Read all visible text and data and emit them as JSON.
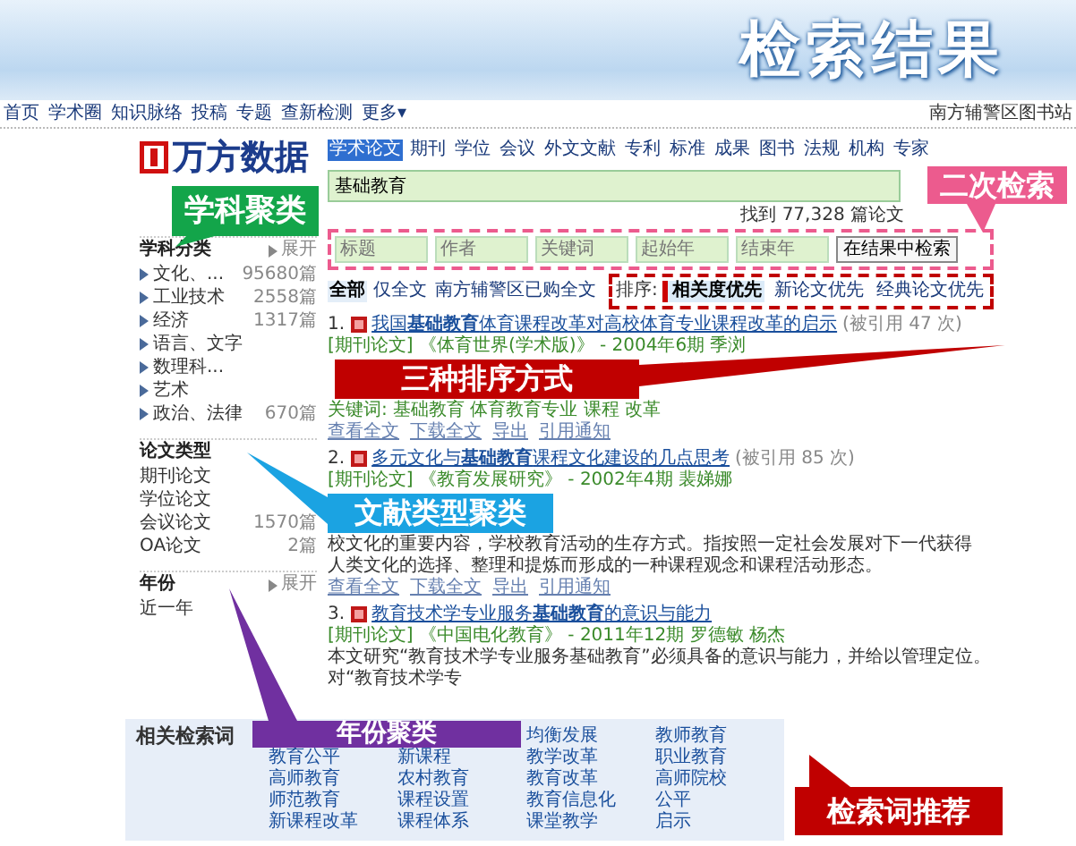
{
  "banner": {
    "title": "检索结果"
  },
  "top_nav": {
    "links": [
      "首页",
      "学术圈",
      "知识脉络",
      "投稿",
      "专题",
      "查新检测",
      "更多▾"
    ],
    "account": "南方辅警区图书站"
  },
  "logo": {
    "text": "万方数据"
  },
  "search": {
    "tabs": [
      {
        "label": "学术论文",
        "selected": true
      },
      {
        "label": "期刊",
        "selected": false
      },
      {
        "label": "学位",
        "selected": false
      },
      {
        "label": "会议",
        "selected": false
      },
      {
        "label": "外文文献",
        "selected": false
      },
      {
        "label": "专利",
        "selected": false
      },
      {
        "label": "标准",
        "selected": false
      },
      {
        "label": "成果",
        "selected": false
      },
      {
        "label": "图书",
        "selected": false
      },
      {
        "label": "法规",
        "selected": false
      },
      {
        "label": "机构",
        "selected": false
      },
      {
        "label": "专家",
        "selected": false
      }
    ],
    "query": "基础教育",
    "found": "找到 77,328 篇论文"
  },
  "refine": {
    "fields": [
      {
        "placeholder": "标题"
      },
      {
        "placeholder": "作者"
      },
      {
        "placeholder": "关键词"
      },
      {
        "placeholder": "起始年"
      },
      {
        "placeholder": "结束年"
      }
    ],
    "button": "在结果中检索"
  },
  "scope": [
    {
      "label": "全部",
      "selected": true
    },
    {
      "label": "仅全文",
      "selected": false
    },
    {
      "label": "南方辅警区已购全文",
      "selected": false
    }
  ],
  "sort": {
    "label": "排序:",
    "options": [
      {
        "label": "相关度优先",
        "selected": true
      },
      {
        "label": "新论文优先",
        "selected": false
      },
      {
        "label": "经典论文优先",
        "selected": false
      }
    ]
  },
  "results": [
    {
      "number": "1.",
      "title": "我国**基础教育**体育课程改革对高校体育专业课程改革的启示",
      "cited": "(被引用 47 次)",
      "meta": "[期刊论文] 《体育世界(学术版)》 - 2004年6期 季浏",
      "keywords": "关键词: 基础教育 体育教育专业 课程 改革",
      "actions": [
        "查看全文",
        "下载全文",
        "导出",
        "引用通知"
      ]
    },
    {
      "number": "2.",
      "title": "多元文化与**基础教育**课程文化建设的几点思考",
      "cited": "(被引用 85 次)",
      "meta": "[期刊论文] 《教育发展研究》 - 2002年4期 裴娣娜",
      "snippet": [
        "校文化的重要内容，学校教育活动的生存方式。指按照一定社会发展对下一代获得",
        "人类文化的选择、整理和提炼而形成的一种课程观念和课程活动形态。"
      ],
      "actions": [
        "查看全文",
        "下载全文",
        "导出",
        "引用通知"
      ]
    },
    {
      "number": "3.",
      "title": "教育技术学专业服务**基础教育**的意识与能力",
      "meta": "[期刊论文] 《中国电化教育》 - 2011年12期 罗德敏 杨杰",
      "snippet": [
        "本文研究“教育技术学专业服务基础教育”必须具备的意识与能力，并给以管理定位。对“教育技术学专"
      ]
    }
  ],
  "sidebar": {
    "sections": [
      {
        "title": "学科分类",
        "expand": "展开",
        "items": [
          {
            "label": "文化、...",
            "count": "95680篇"
          },
          {
            "label": "工业技术",
            "count": "2558篇"
          },
          {
            "label": "经济",
            "count": "1317篇"
          },
          {
            "label": "语言、文字"
          },
          {
            "label": "数理科..."
          },
          {
            "label": "艺术"
          },
          {
            "label": "政治、法律",
            "count": "670篇"
          }
        ]
      },
      {
        "title": "论文类型",
        "items": [
          {
            "label": "期刊论文"
          },
          {
            "label": "学位论文"
          },
          {
            "label": "会议论文",
            "count": "1570篇"
          },
          {
            "label": "OA论文",
            "count": "2篇"
          }
        ]
      },
      {
        "title": "年份",
        "expand": "展开",
        "items": [
          {
            "label": "近一年"
          }
        ]
      }
    ]
  },
  "related": {
    "title": "相关检索词",
    "terms": [
      "均衡发展",
      "教师教育",
      "教育公平",
      "新课程",
      "教学改革",
      "职业教育",
      "高师教育",
      "农村教育",
      "教育改革",
      "高师院校",
      "师范教育",
      "课程设置",
      "教育信息化",
      "公平",
      "新课程改革",
      "课程体系",
      "课堂教学",
      "启示"
    ]
  },
  "callouts": [
    {
      "text": "学科聚类",
      "color": "#13a54a"
    },
    {
      "text": "二次检索",
      "color": "#ec5b8e"
    },
    {
      "text": "三种排序方式",
      "color": "#c00000"
    },
    {
      "text": "文献类型聚类",
      "color": "#1ba3e2"
    },
    {
      "text": "年份聚类",
      "color": "#7030a0"
    },
    {
      "text": "检索词推荐",
      "color": "#c00000"
    }
  ]
}
